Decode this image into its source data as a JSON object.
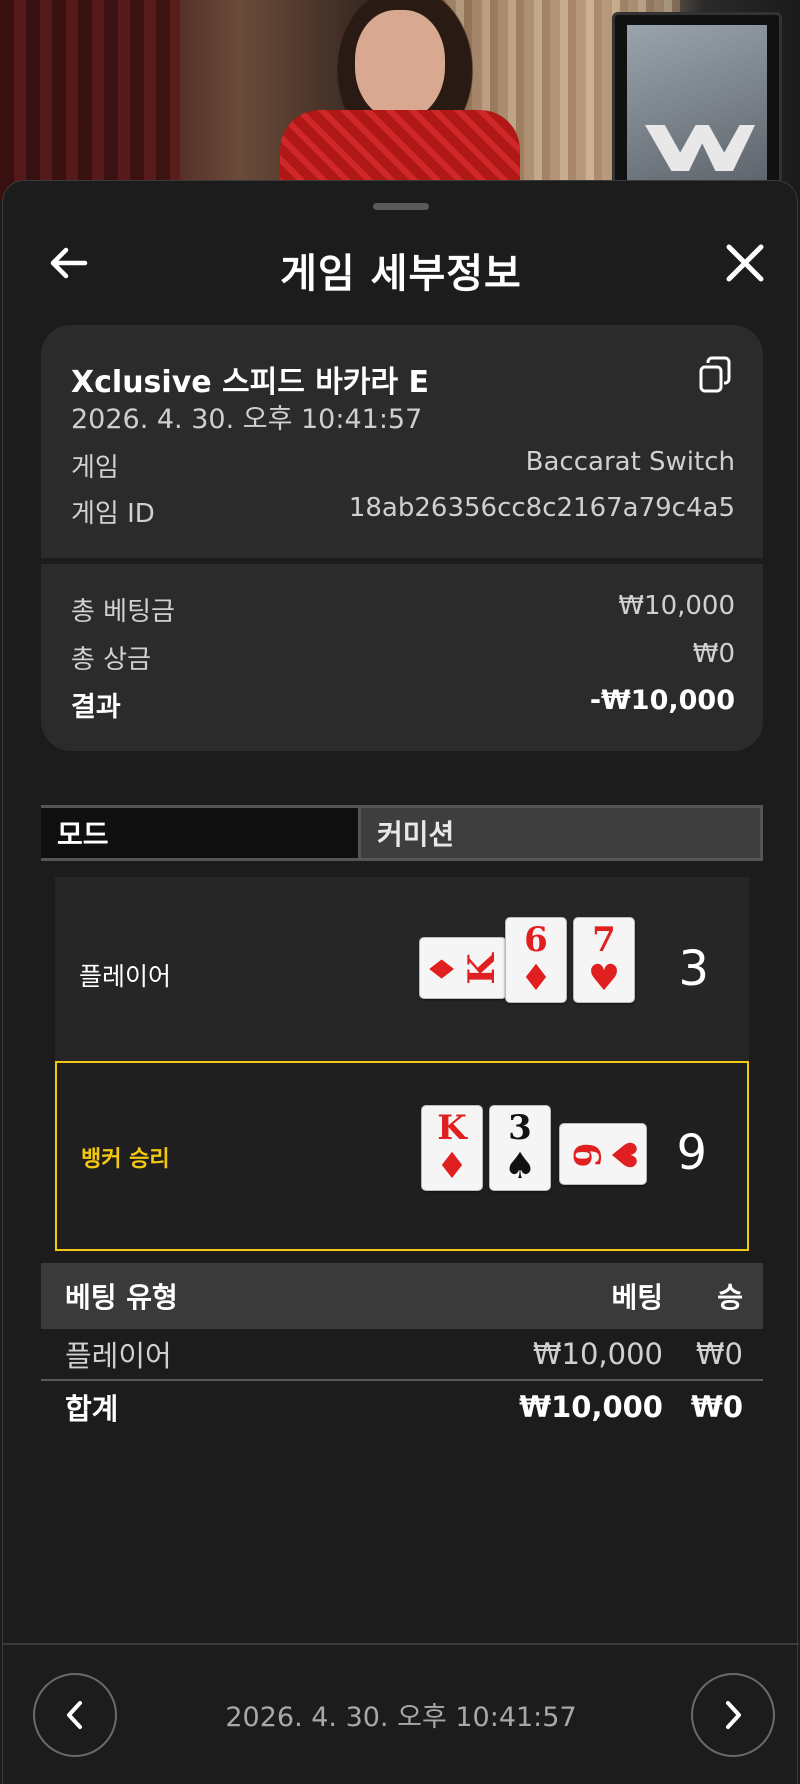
{
  "header": {
    "title": "게임 세부정보",
    "back_icon": "arrow-left-icon",
    "close_icon": "close-icon"
  },
  "summary": {
    "game_name": "Xclusive 스피드 바카라 E",
    "datetime": "2026. 4. 30. 오후 10:41:57",
    "copy_icon": "copy-icon",
    "game_label": "게임",
    "game_value": "Baccarat Switch",
    "game_id_label": "게임 ID",
    "game_id_value": "18ab26356cc8c2167a79c4a5",
    "total_bet_label": "총 베팅금",
    "total_bet_value": "₩10,000",
    "total_win_label": "총 상금",
    "total_win_value": "₩0",
    "result_label": "결과",
    "result_value": "-₩10,000"
  },
  "tabs": {
    "mode": "모드",
    "commission": "커미션"
  },
  "outcome": {
    "player": {
      "label": "플레이어",
      "score": "3",
      "cards": [
        {
          "rank": "K",
          "suit": "♦",
          "color": "red",
          "orientation": "sideways"
        },
        {
          "rank": "6",
          "suit": "♦",
          "color": "red",
          "orientation": "upright"
        },
        {
          "rank": "7",
          "suit": "♥",
          "color": "red",
          "orientation": "upright"
        }
      ]
    },
    "banker": {
      "label": "뱅커 승리",
      "score": "9",
      "highlight_color": "#f2c811",
      "cards": [
        {
          "rank": "K",
          "suit": "♦",
          "color": "red",
          "orientation": "upright"
        },
        {
          "rank": "3",
          "suit": "♠",
          "color": "black",
          "orientation": "upright"
        },
        {
          "rank": "6",
          "suit": "♥",
          "color": "red",
          "orientation": "sideways"
        }
      ]
    }
  },
  "bets": {
    "headers": {
      "type": "베팅 유형",
      "bet": "베팅",
      "win": "승"
    },
    "rows": [
      {
        "type": "플레이어",
        "bet": "₩10,000",
        "win": "₩0"
      }
    ],
    "total": {
      "type": "합계",
      "bet": "₩10,000",
      "win": "₩0"
    }
  },
  "footer": {
    "datetime": "2026. 4. 30. 오후 10:41:57",
    "prev_icon": "chevron-left-icon",
    "next_icon": "chevron-right-icon"
  }
}
